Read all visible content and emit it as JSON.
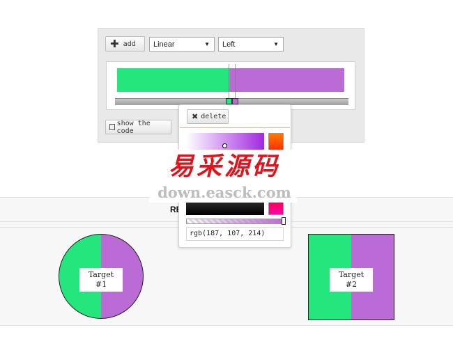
{
  "toolbar": {
    "add_label": "add",
    "type_select": {
      "value": "Linear"
    },
    "direction_select": {
      "value": "Left"
    },
    "show_code_label": "show the code"
  },
  "gradient": {
    "stops": [
      {
        "color": "#25e67d"
      },
      {
        "color": "#bb6bd6"
      }
    ]
  },
  "picker": {
    "delete_label": "delete",
    "value": "rgb(187, 107, 214)",
    "selected_color": "#bb6bd6"
  },
  "stage": {
    "label": "RE",
    "targets": [
      {
        "label": "Target",
        "number": "#1"
      },
      {
        "label": "Target",
        "number": "#2"
      }
    ]
  },
  "watermark": {
    "chinese": "易采源码",
    "url": "down.easck.com"
  }
}
